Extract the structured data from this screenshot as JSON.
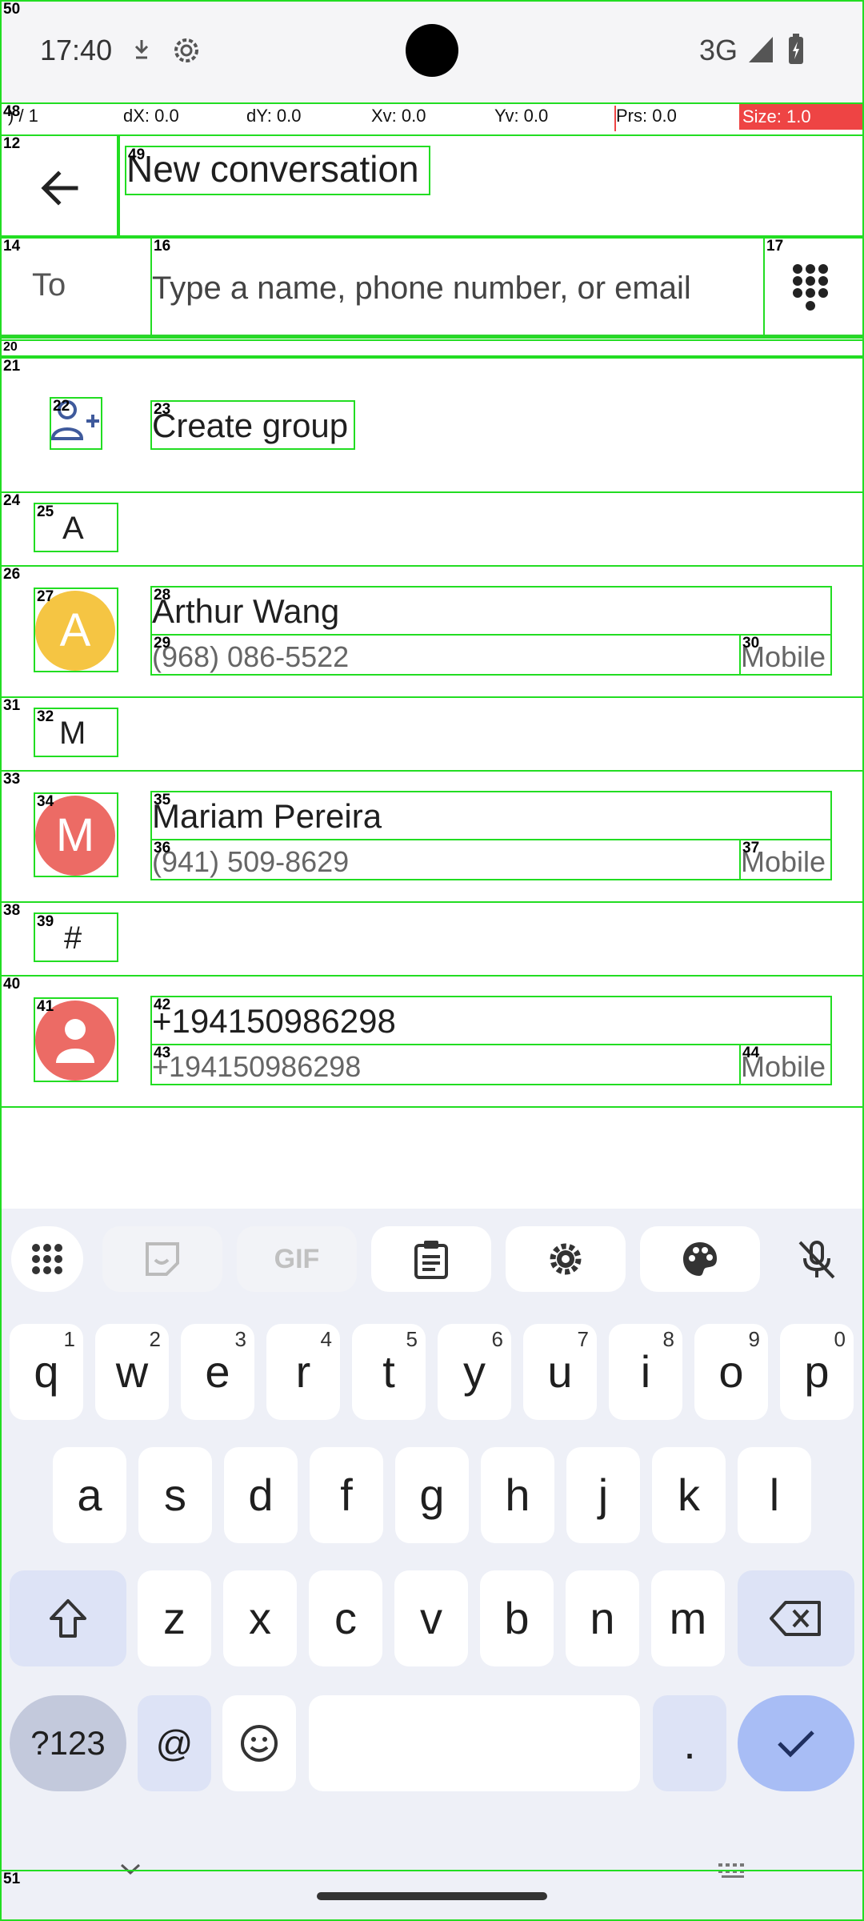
{
  "status": {
    "time": "17:40",
    "network": "3G"
  },
  "pointer": {
    "count": ") / 1",
    "dx": "dX: 0.0",
    "dy": "dY: 0.0",
    "xv": "Xv: 0.0",
    "yv": "Yv: 0.0",
    "prs": "Prs: 0.0",
    "size": "Size: 1.0"
  },
  "appbar": {
    "title": "New conversation",
    "back_icon": "arrow-back-icon"
  },
  "to": {
    "label": "To",
    "placeholder": "Type a name, phone number, or email",
    "value": ""
  },
  "create_group": {
    "label": "Create group",
    "icon": "group-add-icon"
  },
  "contacts": {
    "section_a": "A",
    "arthur": {
      "initial": "A",
      "name": "Arthur Wang",
      "phone": "(968) 086-5522",
      "type": "Mobile",
      "color": "#F5C543"
    },
    "section_m": "M",
    "mariam": {
      "initial": "M",
      "name": "Mariam Pereira",
      "phone": "(941) 509-8629",
      "type": "Mobile",
      "color": "#EC6B65"
    },
    "section_hash": "#",
    "unknown": {
      "name": "+194150986298",
      "phone": "+194150986298",
      "type": "Mobile",
      "color": "#EC6B65"
    }
  },
  "keyboard": {
    "row1": [
      {
        "k": "q",
        "h": "1"
      },
      {
        "k": "w",
        "h": "2"
      },
      {
        "k": "e",
        "h": "3"
      },
      {
        "k": "r",
        "h": "4"
      },
      {
        "k": "t",
        "h": "5"
      },
      {
        "k": "y",
        "h": "6"
      },
      {
        "k": "u",
        "h": "7"
      },
      {
        "k": "i",
        "h": "8"
      },
      {
        "k": "o",
        "h": "9"
      },
      {
        "k": "p",
        "h": "0"
      }
    ],
    "row2": [
      "a",
      "s",
      "d",
      "f",
      "g",
      "h",
      "j",
      "k",
      "l"
    ],
    "row3": [
      "z",
      "x",
      "c",
      "v",
      "b",
      "n",
      "m"
    ],
    "symbols": "?123",
    "at": "@",
    "period": ".",
    "tools": [
      "apps-grid-icon",
      "sticker-icon",
      "GIF",
      "clipboard-icon",
      "settings-icon",
      "palette-icon",
      "mic-off-icon"
    ]
  },
  "overlay_labels": [
    "50",
    "48",
    "12",
    "49",
    "14",
    "16",
    "17",
    "20",
    "21",
    "22",
    "23",
    "24",
    "25",
    "26",
    "27",
    "28",
    "29",
    "30",
    "31",
    "32",
    "33",
    "34",
    "35",
    "36",
    "37",
    "38",
    "39",
    "40",
    "41",
    "42",
    "43",
    "44",
    "51"
  ]
}
